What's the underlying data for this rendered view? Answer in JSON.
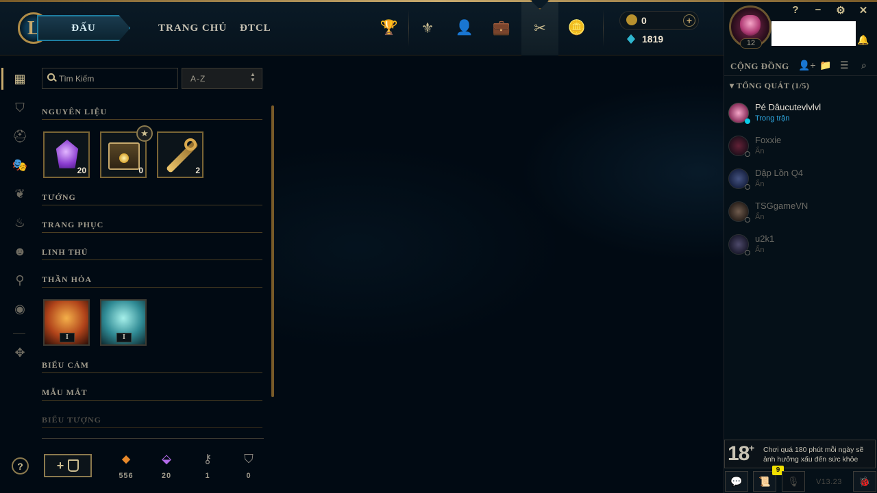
{
  "header": {
    "logo_letter": "L",
    "play_label": "ĐẤU",
    "nav_links": [
      "TRANG CHỦ",
      "ĐTCL"
    ],
    "icons": [
      "trophy-icon",
      "rank-crest-icon",
      "profile-icon",
      "collection-icon",
      "loot-icon",
      "store-icon"
    ],
    "rp_value": "0",
    "be_value": "1819",
    "add_rp_label": "+"
  },
  "window": {
    "help": "?",
    "minimize": "−",
    "settings": "⚙",
    "close": "✕"
  },
  "profile": {
    "level": "12"
  },
  "social": {
    "title": "CỘNG ĐỒNG",
    "group_label": "TỔNG QUÁT (1/5)",
    "friends": [
      {
        "name": "Pé Dâucutevlvlvl",
        "status": "Trong trận",
        "state": "online"
      },
      {
        "name": "Foxxie",
        "status": "Ẩn",
        "state": "offline"
      },
      {
        "name": "Dập Lồn Q4",
        "status": "Ẩn",
        "state": "offline"
      },
      {
        "name": "TSGgameVN",
        "status": "Ẩn",
        "state": "offline"
      },
      {
        "name": "u2k1",
        "status": "Ẩn",
        "state": "offline"
      }
    ]
  },
  "warning": {
    "age": "18",
    "plus": "+",
    "text": "Chơi quá 180 phút mỗi ngày sẽ ảnh hưởng xấu đến sức khỏe"
  },
  "footer_right": {
    "notification_count": "9",
    "version": "V13.23"
  },
  "loot": {
    "search_placeholder": "Tìm Kiếm",
    "sort_value": "A-Z",
    "sections": {
      "materials": "NGUYÊN LIỆU",
      "champions": "TƯỚNG",
      "skins": "TRANG PHỤC",
      "pets": "LINH THÚ",
      "eternals": "THẦN HỎA",
      "emotes": "BIỂU CẢM",
      "wards": "MẪU MẮT",
      "icons": "BIỂU TƯỢNG"
    },
    "materials": [
      {
        "type": "mythic-essence",
        "qty": "20"
      },
      {
        "type": "chest",
        "qty": "0"
      },
      {
        "type": "key",
        "qty": "2"
      }
    ],
    "eternals": [
      {
        "label": "I"
      },
      {
        "label": "I"
      }
    ],
    "craft_label": "+",
    "currencies": [
      {
        "icon": "orange-essence-icon",
        "value": "556",
        "color": "#e8892a"
      },
      {
        "icon": "mythic-essence-icon",
        "value": "20",
        "color": "#b46bea"
      },
      {
        "icon": "key-fragment-icon",
        "value": "1",
        "color": "#8f8c84"
      },
      {
        "icon": "chest-icon",
        "value": "0",
        "color": "#8f8c84"
      }
    ]
  },
  "colors": {
    "gold": "#c8aa6e",
    "background": "#010a13",
    "online": "#0acbe6",
    "accent_blue": "#1e7ea0"
  }
}
